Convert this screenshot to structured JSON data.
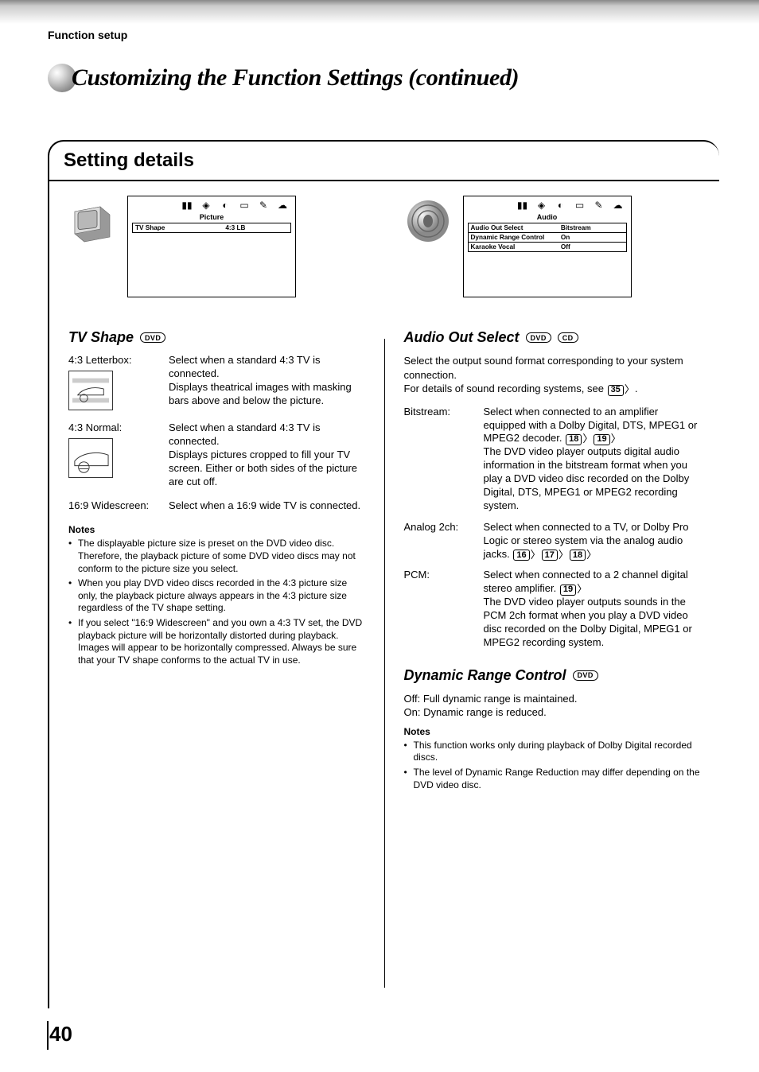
{
  "breadcrumb": "Function setup",
  "page_title": "Customizing the Function Settings (continued)",
  "settings_heading": "Setting details",
  "page_number": "40",
  "left": {
    "osd": {
      "title": "Picture",
      "rows": [
        {
          "key": "TV Shape",
          "val": "4:3 LB"
        }
      ]
    },
    "tv_shape": {
      "heading": "TV Shape",
      "badge_dvd": "DVD",
      "items": [
        {
          "label": "4:3 Letterbox:",
          "body": "Select when a standard 4:3 TV is connected.\nDisplays theatrical images with masking bars above and below the picture."
        },
        {
          "label": "4:3 Normal:",
          "body": "Select when a standard 4:3 TV is connected.\nDisplays pictures cropped to fill your TV screen.  Either or both sides of the picture are cut off."
        },
        {
          "label": "16:9 Widescreen:",
          "body": "Select when a 16:9 wide TV is connected."
        }
      ],
      "notes_head": "Notes",
      "notes": [
        "The displayable picture size is preset on the DVD video disc. Therefore, the playback picture of some DVD video discs may not conform to the picture size you select.",
        "When you play DVD video discs recorded in the 4:3 picture size only, the playback picture always appears in the 4:3 picture size regardless of the TV shape setting.",
        "If you select \"16:9 Widescreen\" and you own a 4:3 TV set, the DVD playback picture will be horizontally distorted during playback. Images will appear to be horizontally compressed.  Always be sure that your TV shape conforms to the actual TV in use."
      ]
    }
  },
  "right": {
    "osd": {
      "title": "Audio",
      "rows": [
        {
          "key": "Audio Out Select",
          "val": "Bitstream"
        },
        {
          "key": "Dynamic Range Control",
          "val": "On"
        },
        {
          "key": "Karaoke Vocal",
          "val": "Off"
        }
      ]
    },
    "audio_out": {
      "heading": "Audio Out Select",
      "badge_dvd": "DVD",
      "badge_cd": "CD",
      "intro1": "Select the output sound format corresponding to your system connection.",
      "intro2_pre": "For details of sound recording systems, see ",
      "intro2_page": "35",
      "items": {
        "bitstream": {
          "label": "Bitstream:",
          "pre": "Select when connected to an amplifier equipped with a Dolby Digital, DTS, MPEG1 or MPEG2 decoder. ",
          "pages": [
            "18",
            "19"
          ],
          "post": "\nThe DVD video player outputs digital audio information in the bitstream format when you play a DVD video disc recorded on the Dolby Digital, DTS, MPEG1 or MPEG2 recording system."
        },
        "analog": {
          "label": "Analog 2ch:",
          "pre": "Select when connected to a TV, or Dolby Pro Logic or stereo system via the analog audio jacks. ",
          "pages": [
            "16",
            "17",
            "18"
          ]
        },
        "pcm": {
          "label": "PCM:",
          "pre": "Select when connected to a 2 channel digital stereo amplifier. ",
          "pages": [
            "19"
          ],
          "post": "\nThe DVD video player outputs sounds in the PCM 2ch format when you play a DVD video disc recorded on the Dolby Digital, MPEG1 or MPEG2 recording system."
        }
      }
    },
    "drc": {
      "heading": "Dynamic Range Control",
      "badge_dvd": "DVD",
      "off_label": "Off:",
      "off_body": "Full dynamic range is maintained.",
      "on_label": "On:",
      "on_body": "Dynamic range is reduced.",
      "notes_head": "Notes",
      "notes": [
        "This function works only during playback of Dolby Digital recorded discs.",
        "The level of Dynamic Range Reduction may differ depending on the DVD video disc."
      ]
    }
  }
}
